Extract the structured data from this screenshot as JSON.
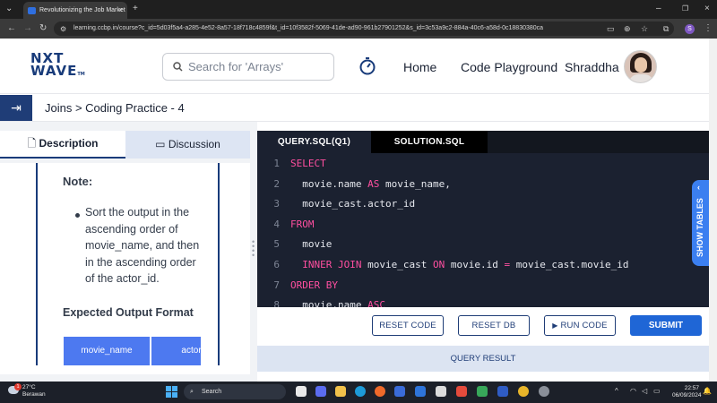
{
  "browser": {
    "tab_title": "Revolutionizing the Job Market",
    "url": "learning.ccbp.in/course?c_id=5d03f5a4-a285-4e52-8a57-18f718c4859f&t_id=10f3582f-5069-41de-ad90-961b27901252&s_id=3c53a9c2-884a-40c6-a58d-0c18830380ca",
    "profile_initial": "S"
  },
  "header": {
    "logo_line1": "NXT",
    "logo_line2": "WAVE",
    "logo_tm": "TM",
    "search_placeholder": "Search for 'Arrays'",
    "nav": [
      "Home",
      "Code Playground"
    ],
    "user_name": "Shraddha"
  },
  "breadcrumb": {
    "text": "Joins > Coding Practice - 4"
  },
  "left_panel": {
    "tabs": [
      "Description",
      "Discussion"
    ],
    "note_title": "Note:",
    "note_bullet": "Sort the output in the ascending order of movie_name, and then in the ascending order of the actor_id.",
    "expected_title": "Expected Output Format",
    "table_headers": [
      "movie_name",
      "actor_id"
    ]
  },
  "editor": {
    "tabs": [
      "QUERY.SQL(Q1)",
      "SOLUTION.SQL"
    ],
    "lines": [
      {
        "n": "1",
        "kw": "SELECT",
        "rest": ""
      },
      {
        "n": "2",
        "kw": "",
        "rest": "  movie.name AS movie_name,"
      },
      {
        "n": "3",
        "kw": "",
        "rest": "  movie_cast.actor_id"
      },
      {
        "n": "4",
        "kw": "FROM",
        "rest": ""
      },
      {
        "n": "5",
        "kw": "",
        "rest": "  movie"
      },
      {
        "n": "6",
        "kw": "",
        "rest": "  INNER JOIN movie_cast ON movie.id = movie_cast.movie_id"
      },
      {
        "n": "7",
        "kw": "ORDER BY",
        "rest": ""
      },
      {
        "n": "8",
        "kw": "",
        "rest": "  movie.name ASC"
      }
    ],
    "show_tables": "SHOW TABLES"
  },
  "actions": {
    "reset_code": "RESET CODE",
    "reset_db": "RESET DB",
    "run_code": "RUN CODE",
    "submit": "SUBMIT",
    "query_result": "QUERY RESULT"
  },
  "taskbar": {
    "temp": "27°C",
    "weather": "Berawan",
    "weather_badge": "1",
    "search": "Search",
    "time": "22:57",
    "date": "06/09/2024"
  },
  "colors": {
    "brand_navy": "#183b7a",
    "accent_blue": "#4d79f0",
    "submit_blue": "#1f66d6",
    "editor_bg": "#1b2130",
    "keyword_pink": "#ff4fa0"
  }
}
